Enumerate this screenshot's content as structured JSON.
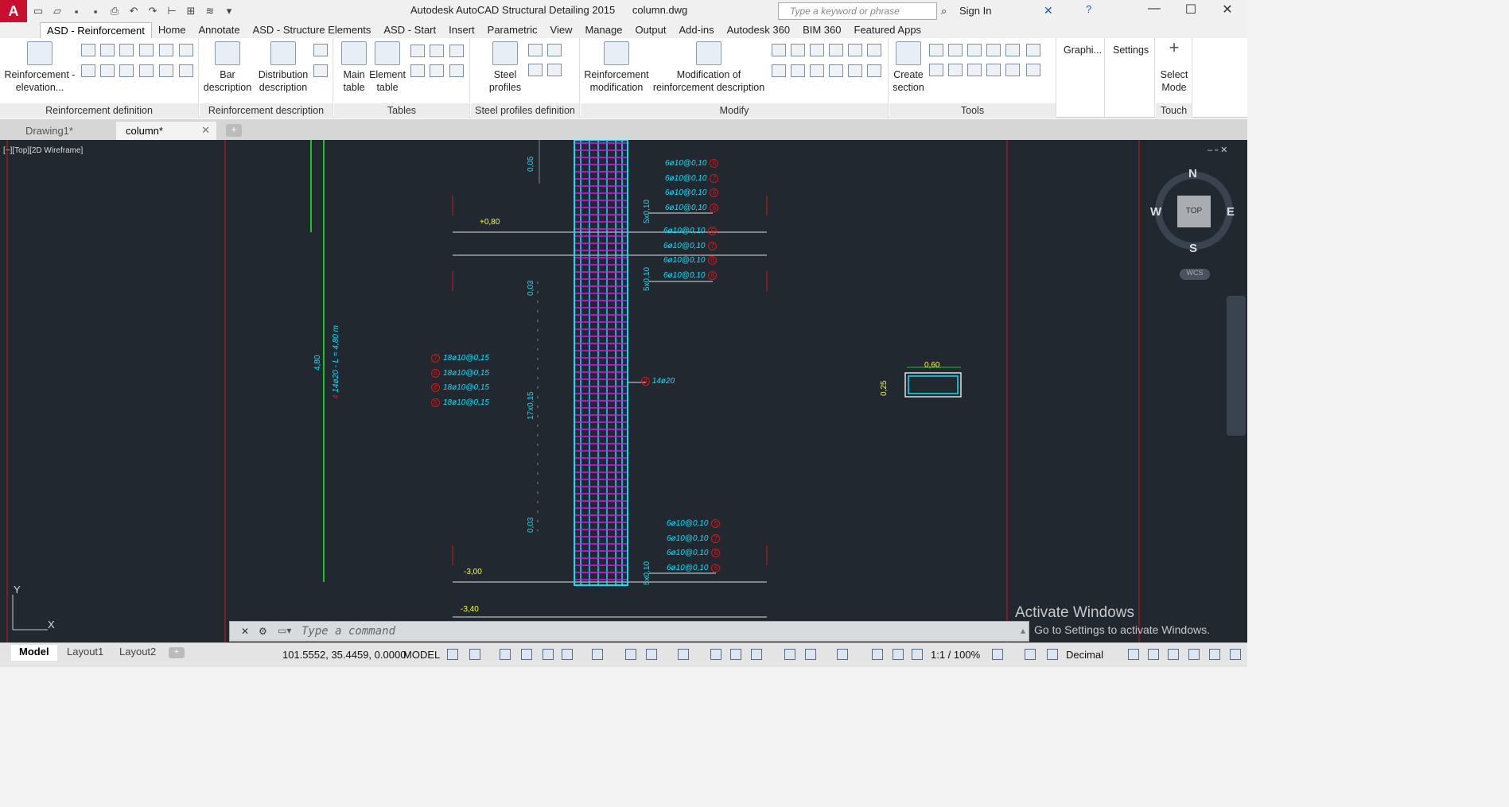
{
  "titlebar": {
    "app": "Autodesk AutoCAD Structural Detailing 2015",
    "file": "column.dwg",
    "search_placeholder": "Type a keyword or phrase",
    "signin": "Sign In"
  },
  "ribbon_tabs": [
    "ASD - Reinforcement",
    "Home",
    "Annotate",
    "ASD - Structure Elements",
    "ASD - Start",
    "Insert",
    "Parametric",
    "View",
    "Manage",
    "Output",
    "Add-ins",
    "Autodesk 360",
    "BIM 360",
    "Featured Apps"
  ],
  "ribbon": {
    "reinforcement_elevation": "Reinforcement - elevation...",
    "reinforcement_definition": "Reinforcement definition",
    "bar_description": "Bar description",
    "distribution_description": "Distribution description",
    "reinforcement_description": "Reinforcement description",
    "main_table": "Main table",
    "element_table": "Element table",
    "tables": "Tables",
    "steel_profiles": "Steel profiles",
    "steel_profiles_definition": "Steel profiles definition",
    "reinforcement_modification": "Reinforcement modification",
    "modification_of_reinforcement_description": "Modification of reinforcement description",
    "modify": "Modify",
    "create_section": "Create section",
    "tools": "Tools",
    "graphics": "Graphi...",
    "settings": "Settings",
    "select_mode": "Select Mode",
    "touch": "Touch"
  },
  "doc_tabs": [
    "Drawing1*",
    "column*"
  ],
  "viewport": {
    "label": "[−][Top][2D Wireframe]",
    "compass": {
      "n": "N",
      "s": "S",
      "e": "E",
      "w": "W",
      "top": "TOP",
      "wcs": "WCS"
    },
    "ucs": {
      "x": "X",
      "y": "Y"
    }
  },
  "drawing": {
    "level_080": "+0,80",
    "level_300": "-3,00",
    "level_340": "-3,40",
    "dim_005": "0,05",
    "dim_003": "0,03",
    "dim_17x015": "17x0,15",
    "dim_5x010": "5x0,10",
    "dim_480": "4,80",
    "bar_label_vertical": "14ø20 - L = 4,80 m",
    "main_bar": "14ø20",
    "top_group1": [
      "6ø10@0,10",
      "6ø10@0,10",
      "6ø10@0,10",
      "6ø10@0,10"
    ],
    "top_group1_marks": [
      "5",
      "7",
      "6",
      "6"
    ],
    "top_group2": [
      "6ø10@0,10",
      "6ø10@0,10",
      "6ø10@0,10",
      "6ø10@0,10"
    ],
    "top_group2_marks": [
      "5",
      "7",
      "6",
      "6"
    ],
    "mid_group": [
      "18ø10@0,15",
      "18ø10@0,15",
      "18ø10@0,15",
      "18ø10@0,15"
    ],
    "mid_group_marks": [
      "7",
      "6",
      "6",
      "5"
    ],
    "bottom_group": [
      "6ø10@0,10",
      "6ø10@0,10",
      "6ø10@0,10",
      "6ø10@0,10"
    ],
    "bottom_group_marks": [
      "5",
      "7",
      "6",
      "6"
    ],
    "bar_mark_4": "4",
    "section_width": "0,60",
    "section_depth": "0,25"
  },
  "command": {
    "placeholder": "Type a command"
  },
  "activate": {
    "line1": "Activate Windows",
    "line2": "Go to Settings to activate Windows."
  },
  "statusbar": {
    "layouts": [
      "Model",
      "Layout1",
      "Layout2"
    ],
    "coords": "101.5552, 35.4459, 0.0000",
    "space": "MODEL",
    "scale": "1:1 / 100%",
    "units": "Decimal"
  },
  "colors": {
    "canvas": "#212830",
    "cyan": "#00e5ff",
    "magenta": "#ff00ff",
    "green": "#22c022",
    "red": "#d21818",
    "yellow": "#ffff00"
  }
}
